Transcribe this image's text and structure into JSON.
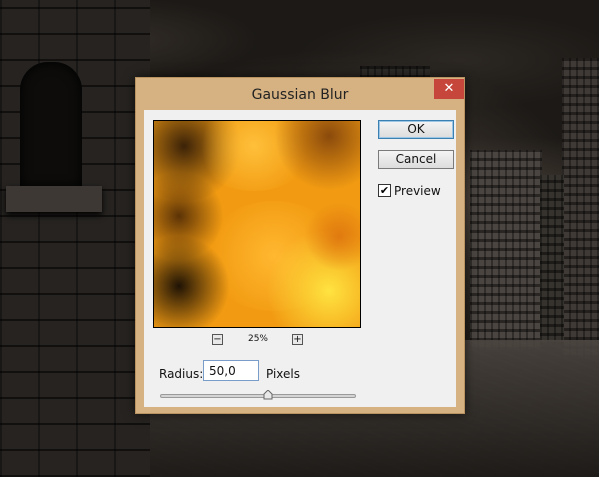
{
  "dialog": {
    "title": "Gaussian Blur",
    "close_glyph": "✕",
    "ok_label": "OK",
    "cancel_label": "Cancel",
    "preview_label": "Preview",
    "preview_checked": true,
    "zoom_out_glyph": "−",
    "zoom_in_glyph": "+",
    "zoom_level": "25%",
    "radius_label": "Radius:",
    "radius_value": "50,0",
    "radius_unit": "Pixels",
    "radius_slider_fraction": 0.55
  },
  "colors": {
    "titlebar": "#d6b283",
    "close_button": "#c7463b",
    "dialog_body": "#f0f0f0",
    "ok_border": "#3c7fb1",
    "preview_orange": "#f29b12",
    "preview_yellow": "#ffd93a"
  },
  "icons": {
    "close": "close-icon",
    "zoom_out": "zoom-out-icon",
    "zoom_in": "zoom-in-icon",
    "checkmark": "checkmark-icon",
    "slider_thumb": "slider-thumb-icon"
  }
}
